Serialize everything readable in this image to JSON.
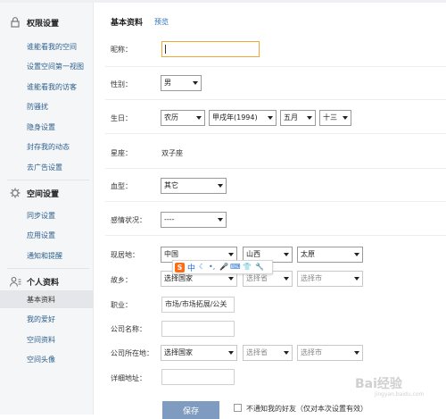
{
  "sidebar": {
    "sections": [
      {
        "title": "权限设置",
        "icon": "lock-icon",
        "items": [
          "谁能看我的空间",
          "设置空间第一视图",
          "谁能看我的访客",
          "防骚扰",
          "隐身设置",
          "封存我的动态",
          "去广告设置"
        ]
      },
      {
        "title": "空间设置",
        "icon": "gear-icon",
        "items": [
          "同步设置",
          "应用设置",
          "通知和提醒"
        ]
      },
      {
        "title": "个人资料",
        "icon": "user-icon",
        "items": [
          "基本资料",
          "我的爱好",
          "空间资料",
          "空间头像"
        ],
        "active_index": 0
      }
    ]
  },
  "main": {
    "title": "基本资料",
    "preview": "预览",
    "fields": {
      "nickname": {
        "label": "昵称：",
        "value": ""
      },
      "gender": {
        "label": "性别：",
        "value": "男"
      },
      "birthday": {
        "label": "生日：",
        "calendar": "农历",
        "year": "甲戌年(1994)",
        "month": "五月",
        "day": "十三"
      },
      "zodiac": {
        "label": "星座：",
        "value": "双子座"
      },
      "blood": {
        "label": "血型：",
        "value": "其它"
      },
      "relationship": {
        "label": "感情状况：",
        "value": "----"
      },
      "residence": {
        "label": "现居地：",
        "country": "中国",
        "province": "山西",
        "city": "太原"
      },
      "hometown": {
        "label": "故乡：",
        "country": "选择国家",
        "province": "选择省",
        "city": "选择市"
      },
      "job": {
        "label": "职业：",
        "value": "市场/市场拓展/公关"
      },
      "company": {
        "label": "公司名称：",
        "value": ""
      },
      "company_location": {
        "label": "公司所在地：",
        "country": "选择国家",
        "province": "选择省",
        "city": "选择市"
      },
      "address": {
        "label": "详细地址：",
        "value": ""
      }
    },
    "save": "保存",
    "notify": "不通知我的好友（仅对本次设置有效）"
  },
  "ime": {
    "logo": "S",
    "mode": "中"
  },
  "watermark": {
    "main": "Bai经验",
    "sub": "jingyan.baidu.com"
  }
}
